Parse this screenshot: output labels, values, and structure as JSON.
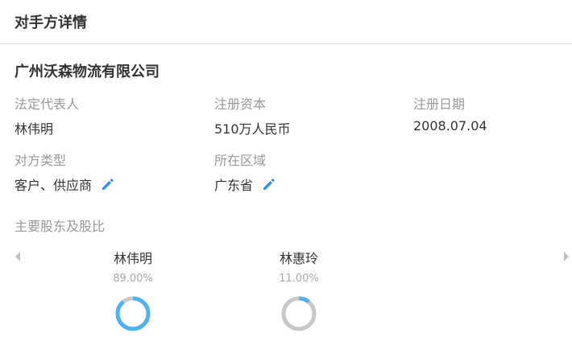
{
  "header": {
    "title": "对手方详情"
  },
  "company": {
    "name": "广州沃森物流有限公司"
  },
  "fields": {
    "legal_rep": {
      "label": "法定代表人",
      "value": "林伟明"
    },
    "capital": {
      "label": "注册资本",
      "value": "510万人民币"
    },
    "reg_date": {
      "label": "注册日期",
      "value": "2008.07.04"
    },
    "party_type": {
      "label": "对方类型",
      "value": "客户、供应商"
    },
    "region": {
      "label": "所在区域",
      "value": "广东省"
    }
  },
  "shareholders": {
    "label": "主要股东及股比",
    "items": [
      {
        "name": "林伟明",
        "pct_label": "89.00%",
        "pct": 0.89
      },
      {
        "name": "林惠玲",
        "pct_label": "11.00%",
        "pct": 0.11
      }
    ]
  },
  "colors": {
    "accent": "#4db3f5",
    "ring_track": "#c8c8c8",
    "edit_icon": "#3a8ee6",
    "arrow": "#c0c0c0"
  },
  "icons": {
    "edit": "pencil-icon",
    "prev": "arrow-left-icon",
    "next": "arrow-right-icon"
  }
}
